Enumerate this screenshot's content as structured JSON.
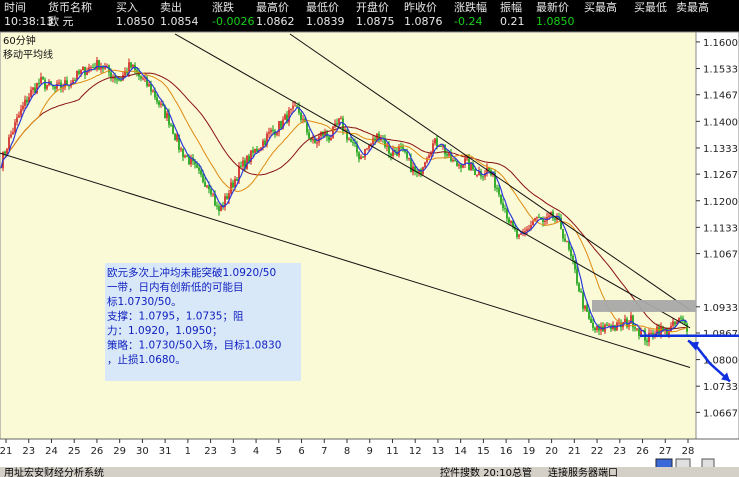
{
  "quote": {
    "headers": [
      "时间",
      "货币名称",
      "买入",
      "卖出",
      "涨跌",
      "最高价",
      "最低价",
      "开盘价",
      "昨收价",
      "涨跌幅",
      "振幅",
      "最新价",
      "买最高",
      "买最低",
      "卖最高"
    ],
    "values": [
      "10:38:13",
      "欧 元",
      "1.0850",
      "1.0854",
      "-0.0026",
      "1.0862",
      "1.0839",
      "1.0875",
      "1.0876",
      "-0.24",
      "0.21",
      "1.0850",
      "",
      "",
      ""
    ]
  },
  "chart_labels": {
    "period": "60分钟",
    "indicator": "移动平均线"
  },
  "annotation": [
    "欧元多次上冲均未能突破1.0920/50",
    "一带，日内有创新低的可能目",
    "标1.0730/50。",
    "支撑：1.0795，1.0735；阻",
    "力：1.0920，1.0950；",
    "策略：1.0730/50入场，目标1.0830",
    "，止损1.0680。"
  ],
  "bottom_texts": [
    "用址宏安财经分析系统",
    "控件搜数 20:10总管",
    "连接服务器端口"
  ],
  "colors": {
    "plot_bg": "#fafad6",
    "axis_bg": "#ffffff",
    "up_candle": "#d01818",
    "down_candle": "#089a08",
    "ma_short": "#2a3ad8",
    "ma_mid": "#e08a10",
    "ma_long": "#8a1010",
    "annotation_bg": "#d8e8f8",
    "blue_arrow": "#1030e0"
  },
  "chart_data": {
    "type": "candlestick",
    "title": "",
    "y_ticks": [
      1.16,
      1.1533,
      1.1467,
      1.14,
      1.1333,
      1.1267,
      1.12,
      1.1133,
      1.1067,
      1.0933,
      1.0867,
      1.08,
      1.0733,
      1.0667
    ],
    "y_tick_labels": [
      "1.1600",
      "1.1533",
      "1.1467",
      "1.1400",
      "1.1333",
      "1.1267",
      "1.1200",
      "1.1133",
      "1.1067",
      "1.0933",
      "1.0867",
      "1.0800",
      "1.0733",
      "1.0667"
    ],
    "ylim": [
      1.06,
      1.1625
    ],
    "x_tick_labels": [
      "21",
      "23",
      "24",
      "25",
      "26",
      "29",
      "30",
      "31",
      "1",
      "23",
      "3",
      "4",
      "5",
      "6",
      "7",
      "8",
      "9",
      "11",
      "12",
      "13",
      "14",
      "15",
      "16",
      "19",
      "20",
      "21",
      "22",
      "23",
      "26",
      "27",
      "28"
    ],
    "price_path": [
      [
        0,
        1.129
      ],
      [
        10,
        1.136
      ],
      [
        20,
        1.142
      ],
      [
        30,
        1.147
      ],
      [
        40,
        1.15
      ],
      [
        55,
        1.148
      ],
      [
        70,
        1.15
      ],
      [
        85,
        1.153
      ],
      [
        100,
        1.1545
      ],
      [
        110,
        1.152
      ],
      [
        120,
        1.1505
      ],
      [
        130,
        1.154
      ],
      [
        140,
        1.151
      ],
      [
        152,
        1.148
      ],
      [
        160,
        1.144
      ],
      [
        170,
        1.14
      ],
      [
        180,
        1.133
      ],
      [
        190,
        1.13
      ],
      [
        200,
        1.126
      ],
      [
        210,
        1.124
      ],
      [
        218,
        1.117
      ],
      [
        225,
        1.12
      ],
      [
        232,
        1.124
      ],
      [
        240,
        1.128
      ],
      [
        250,
        1.131
      ],
      [
        260,
        1.134
      ],
      [
        270,
        1.137
      ],
      [
        280,
        1.139
      ],
      [
        290,
        1.142
      ],
      [
        298,
        1.143
      ],
      [
        306,
        1.138
      ],
      [
        314,
        1.134
      ],
      [
        322,
        1.137
      ],
      [
        330,
        1.136
      ],
      [
        340,
        1.14
      ],
      [
        350,
        1.135
      ],
      [
        360,
        1.131
      ],
      [
        370,
        1.134
      ],
      [
        380,
        1.137
      ],
      [
        390,
        1.132
      ],
      [
        400,
        1.133
      ],
      [
        410,
        1.129
      ],
      [
        418,
        1.126
      ],
      [
        425,
        1.131
      ],
      [
        432,
        1.134
      ],
      [
        440,
        1.135
      ],
      [
        448,
        1.131
      ],
      [
        456,
        1.129
      ],
      [
        464,
        1.13
      ],
      [
        472,
        1.128
      ],
      [
        480,
        1.127
      ],
      [
        488,
        1.128
      ],
      [
        496,
        1.124
      ],
      [
        504,
        1.119
      ],
      [
        512,
        1.113
      ],
      [
        520,
        1.11
      ],
      [
        528,
        1.113
      ],
      [
        536,
        1.116
      ],
      [
        544,
        1.114
      ],
      [
        552,
        1.116
      ],
      [
        560,
        1.114
      ],
      [
        568,
        1.108
      ],
      [
        576,
        1.101
      ],
      [
        584,
        1.093
      ],
      [
        592,
        1.088
      ],
      [
        600,
        1.087
      ],
      [
        608,
        1.089
      ],
      [
        616,
        1.088
      ],
      [
        624,
        1.089
      ],
      [
        632,
        1.09
      ],
      [
        640,
        1.087
      ],
      [
        648,
        1.085
      ],
      [
        656,
        1.088
      ],
      [
        664,
        1.087
      ],
      [
        672,
        1.088
      ],
      [
        680,
        1.09
      ],
      [
        688,
        1.088
      ]
    ],
    "trend_lines": [
      {
        "from": [
          0,
          1.132
        ],
        "to": [
          690,
          1.078
        ]
      },
      {
        "from": [
          175,
          1.162
        ],
        "to": [
          690,
          1.088
        ]
      },
      {
        "from": [
          290,
          1.162
        ],
        "to": [
          690,
          1.0925
        ]
      }
    ],
    "resistance_band": [
      1.092,
      1.095
    ],
    "support_level": 1.086,
    "target_arrow": {
      "from": [
        696,
        1.086
      ],
      "mid": [
        710,
        1.079
      ],
      "to": [
        730,
        1.0745
      ]
    }
  }
}
